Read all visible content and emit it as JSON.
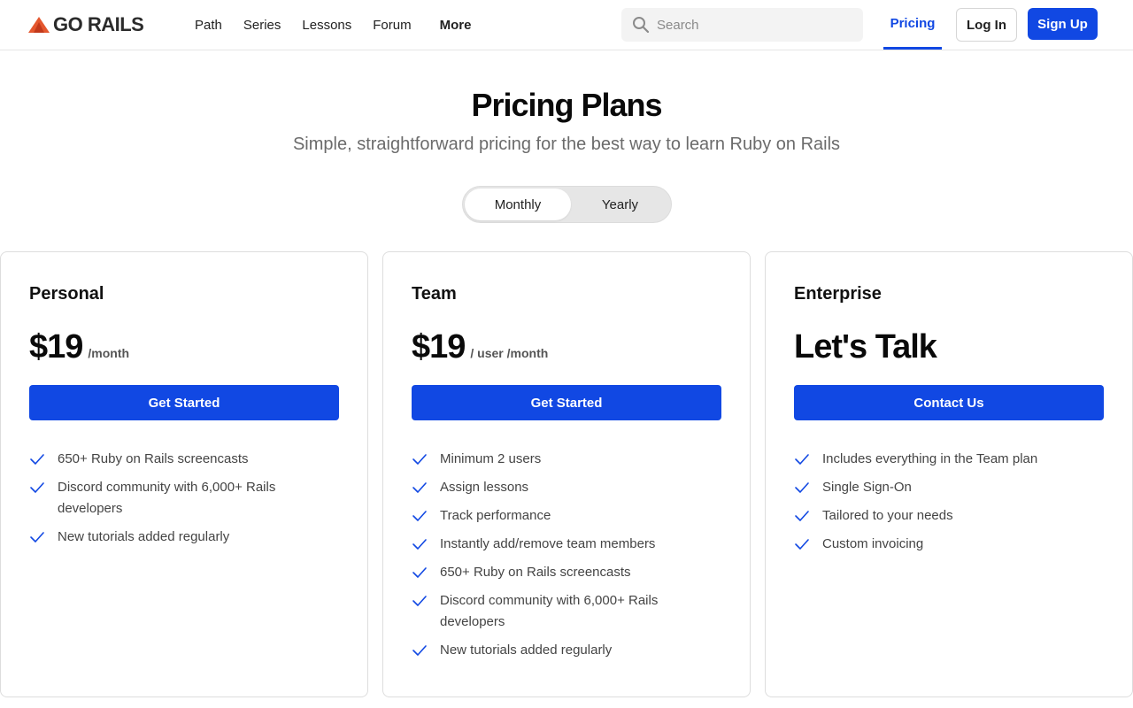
{
  "header": {
    "logo_text": "GO RAILS",
    "nav": [
      "Path",
      "Series",
      "Lessons",
      "Forum"
    ],
    "more_label": "More",
    "search": {
      "placeholder": "Search"
    },
    "pricing_label": "Pricing",
    "login_label": "Log In",
    "signup_label": "Sign Up"
  },
  "hero": {
    "title": "Pricing Plans",
    "subtitle": "Simple, straightforward pricing for the best way to learn Ruby on Rails"
  },
  "billing_toggle": {
    "monthly": "Monthly",
    "yearly": "Yearly",
    "selected": "Monthly"
  },
  "plans": [
    {
      "name": "Personal",
      "price": "$19",
      "unit": "/month",
      "cta": "Get Started",
      "features": [
        "650+ Ruby on Rails screencasts",
        "Discord community with 6,000+ Rails developers",
        "New tutorials added regularly"
      ]
    },
    {
      "name": "Team",
      "price": "$19",
      "unit": "/ user /month",
      "cta": "Get Started",
      "features": [
        "Minimum 2 users",
        "Assign lessons",
        "Track performance",
        "Instantly add/remove team members",
        "650+ Ruby on Rails screencasts",
        "Discord community with 6,000+ Rails developers",
        "New tutorials added regularly"
      ]
    },
    {
      "name": "Enterprise",
      "price": "Let's Talk",
      "unit": "",
      "cta": "Contact Us",
      "features": [
        "Includes everything in the Team plan",
        "Single Sign-On",
        "Tailored to your needs",
        "Custom invoicing"
      ]
    }
  ],
  "colors": {
    "accent": "#1148e3",
    "logo_flame": "#e4572e"
  },
  "icons": {
    "logo": "rails-flame-icon",
    "search": "search-icon",
    "feature": "check-icon"
  }
}
